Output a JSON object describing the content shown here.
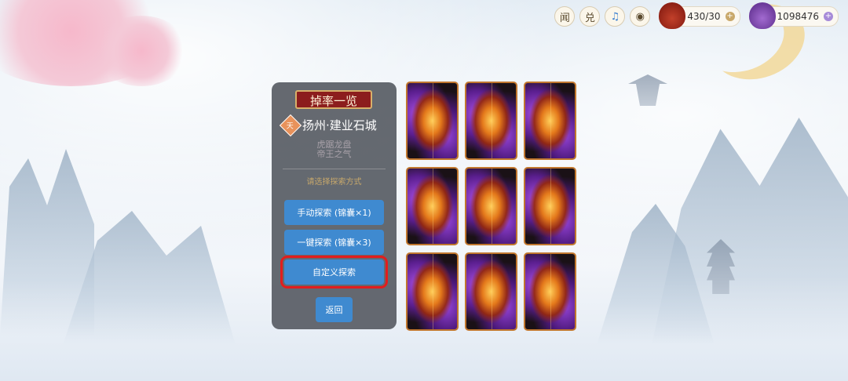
{
  "topbar": {
    "btn_1": "闻",
    "btn_2": "兑",
    "music_icon": "♫",
    "view_icon": "◉",
    "currency_1": {
      "value": "430/30",
      "icon": "red-pouch-icon",
      "color": "#b33a24"
    },
    "currency_2": {
      "value": "1098476",
      "icon": "purple-pouch-icon",
      "color": "#7b46ad"
    }
  },
  "panel": {
    "title": "掉率一览",
    "location_badge": "天",
    "location": "扬州·建业石城",
    "slogan_1": "虎踞龙盘",
    "slogan_2": "帝王之气",
    "hint": "请选择探索方式",
    "buttons": {
      "manual": "手动探索 (锦囊×1)",
      "one_click": "一键探索 (锦囊×3)",
      "custom": "自定义探索",
      "back": "返回"
    }
  },
  "cards": {
    "count": 9,
    "face": "card-back"
  },
  "colors": {
    "button": "#3f8ad0",
    "highlight": "#e21d1d",
    "title_bg": "#8c1d1d",
    "card_border": "#c1772e"
  }
}
